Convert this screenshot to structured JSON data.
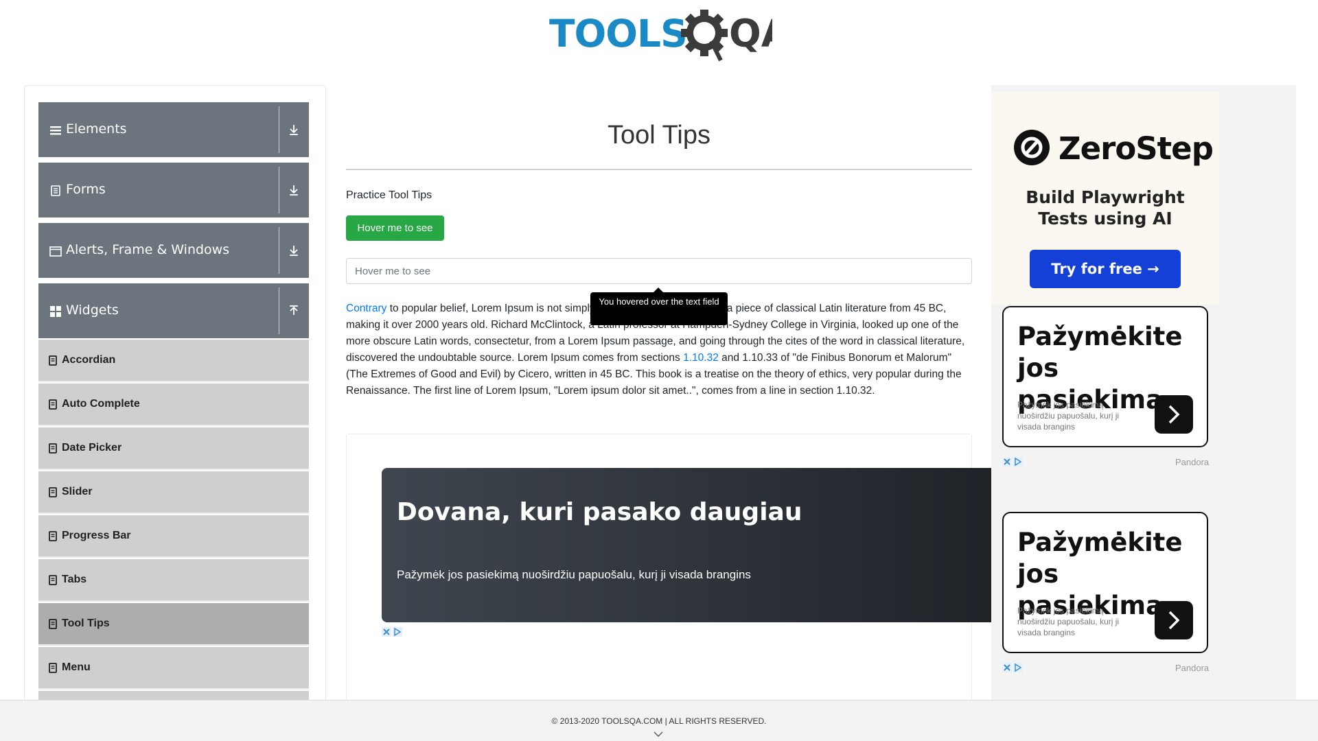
{
  "header": {
    "logo_text_left": "TOOLS",
    "logo_text_right": "QA",
    "logo_color": "#1a8ac6"
  },
  "sidebar": {
    "groups": [
      {
        "label": "Elements",
        "icon": "hamburger-icon",
        "arrow": "download-icon"
      },
      {
        "label": "Forms",
        "icon": "document-icon",
        "arrow": "download-icon"
      },
      {
        "label": "Alerts, Frame & Windows",
        "icon": "window-icon",
        "arrow": "download-icon"
      },
      {
        "label": "Widgets",
        "icon": "widgets-grid-icon",
        "arrow": "upload-icon"
      }
    ],
    "items": [
      {
        "label": "Accordian"
      },
      {
        "label": "Auto Complete"
      },
      {
        "label": "Date Picker"
      },
      {
        "label": "Slider"
      },
      {
        "label": "Progress Bar"
      },
      {
        "label": "Tabs"
      },
      {
        "label": "Tool Tips",
        "active": true
      },
      {
        "label": "Menu"
      }
    ]
  },
  "main": {
    "title": "Tool Tips",
    "practice_label": "Practice Tool Tips",
    "hover_button_label": "Hover me to see",
    "hover_input_placeholder": "Hover me to see",
    "tooltip_text": "You hovered over the text field",
    "paragraph": {
      "link1": "Contrary",
      "text1": " to popular belief, Lorem Ipsum is not simply random text. It has roots in a piece of classical Latin literature from 45 BC, making it over 2000 years old. Richard McClintock, a Latin professor at Hampden-Sydney College in Virginia, looked up one of the more obscure Latin words, consectetur, from a Lorem Ipsum passage, and going through the cites of the word in classical literature, discovered the undoubtable source. Lorem Ipsum comes from sections ",
      "link2": "1.10.32",
      "text2": " and 1.10.33 of \"de Finibus Bonorum et Malorum\" (The Extremes of Good and Evil) by Cicero, written in 45 BC. This book is a treatise on the theory of ethics, very popular during the Renaissance. The first line of Lorem Ipsum, \"Lorem ipsum dolor sit amet..\", comes from a line in section 1.10.32."
    }
  },
  "ads": {
    "banner": {
      "title": "Dovana, kuri pasako daugiau",
      "subtitle": "Pažymėk jos pasiekimą nuoširdžiu papuošalu, kurį ji visada brangins"
    },
    "zerostep": {
      "name": "ZeroStep",
      "tagline_line1": "Build Playwright",
      "tagline_line2": "Tests using AI",
      "button": "Try for free →"
    },
    "pandora_cards": [
      {
        "title_line1": "Pažymėkite",
        "title_line2": "jos pasiekimą",
        "subtitle": "Pažymėk jos pasiekimą nuoširdžiu papuošalu, kurį ji visada brangins",
        "brand": "Pandora"
      },
      {
        "title_line1": "Pažymėkite",
        "title_line2": "jos pasiekimą",
        "subtitle": "Pažymėk jos pasiekimą nuoširdžiu papuošalu, kurį ji visada brangins",
        "brand": "Pandora"
      }
    ]
  },
  "footer": {
    "text": "© 2013-2020 TOOLSQA.COM | ALL RIGHTS RESERVED."
  },
  "colors": {
    "sidebar_group_bg": "#6c757d",
    "sidebar_item_bg": "#cfcfcf",
    "sidebar_item_active_bg": "#adadad",
    "button_green": "#28a745",
    "link_blue": "#007bff",
    "zerostep_button": "#1540d8"
  }
}
